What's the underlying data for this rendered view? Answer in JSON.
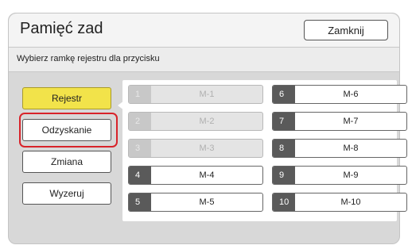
{
  "header": {
    "title": "Pamięć zad",
    "close_label": "Zamknij"
  },
  "instruction": "Wybierz ramkę rejestru dla przycisku",
  "menu": [
    {
      "label": "Rejestr",
      "active": true
    },
    {
      "label": "Odzyskanie",
      "highlighted": true
    },
    {
      "label": "Zmiana"
    },
    {
      "label": "Wyzeruj"
    }
  ],
  "slots": [
    {
      "num": "1",
      "name": "M-1",
      "enabled": false
    },
    {
      "num": "2",
      "name": "M-2",
      "enabled": false
    },
    {
      "num": "3",
      "name": "M-3",
      "enabled": false
    },
    {
      "num": "4",
      "name": "M-4",
      "enabled": true
    },
    {
      "num": "5",
      "name": "M-5",
      "enabled": true
    },
    {
      "num": "6",
      "name": "M-6",
      "enabled": true
    },
    {
      "num": "7",
      "name": "M-7",
      "enabled": true
    },
    {
      "num": "8",
      "name": "M-8",
      "enabled": true
    },
    {
      "num": "9",
      "name": "M-9",
      "enabled": true
    },
    {
      "num": "10",
      "name": "M-10",
      "enabled": true
    }
  ],
  "colors": {
    "accent_yellow": "#f2e34a",
    "highlight_red": "#d8232a"
  }
}
